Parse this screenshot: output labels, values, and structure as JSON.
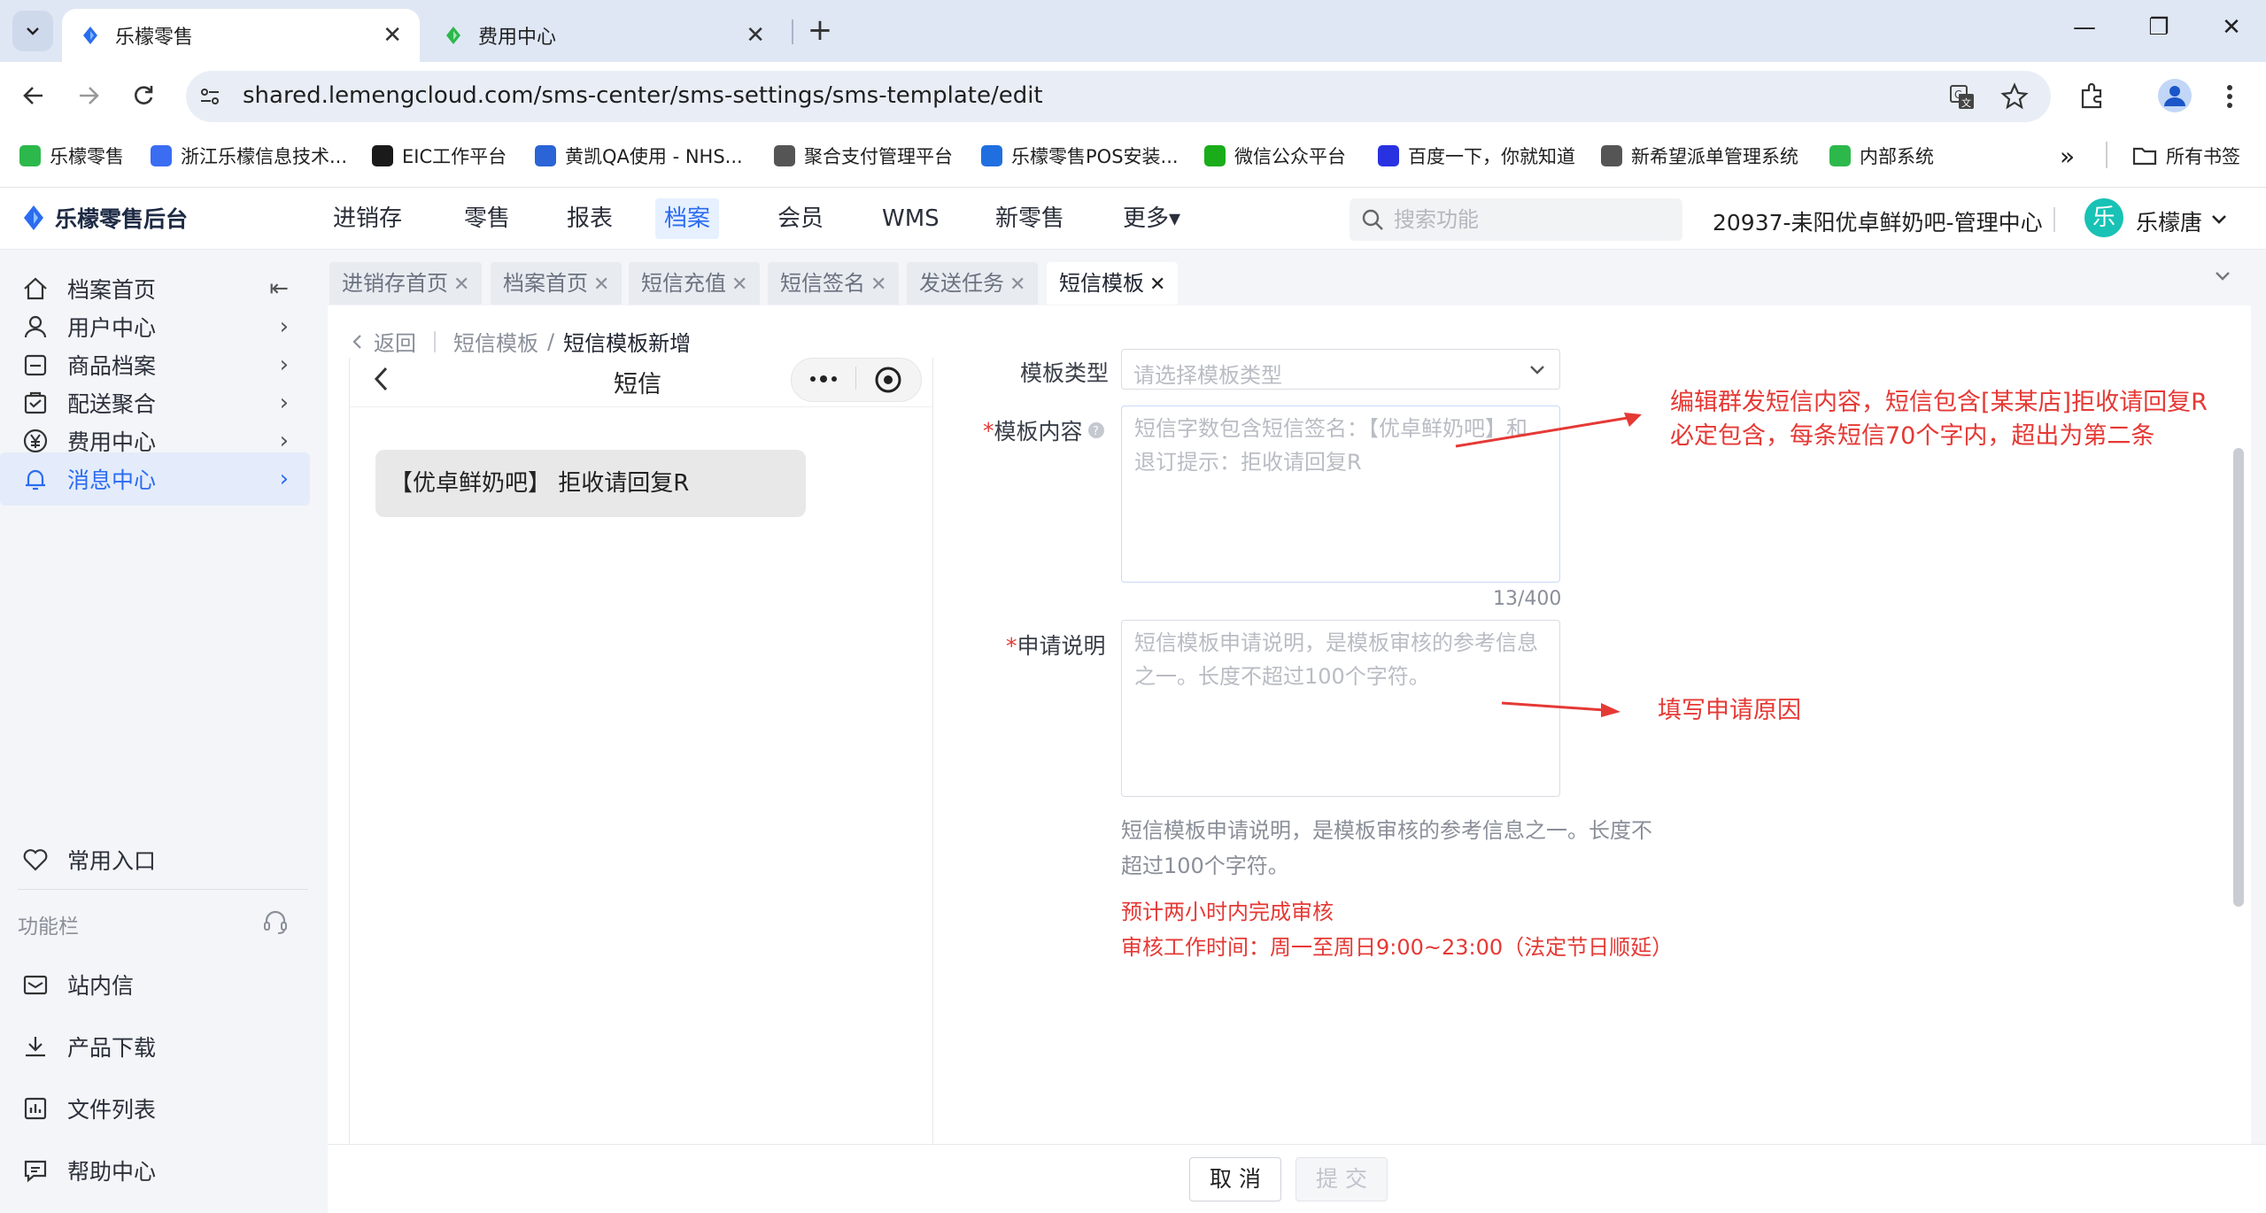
{
  "browser": {
    "tabs": [
      {
        "title": "乐檬零售",
        "active": true
      },
      {
        "title": "费用中心",
        "active": false
      }
    ],
    "close_glyph": "✕",
    "new_tab_glyph": "+",
    "url": "shared.lemengcloud.com/sms-center/sms-settings/sms-template/edit",
    "window_controls": {
      "minimize": "—",
      "restore": "❐",
      "close": "✕"
    },
    "bookmarks": [
      {
        "label": "乐檬零售",
        "color": "#2db84c"
      },
      {
        "label": "浙江乐檬信息技术...",
        "color": "#3b6df2"
      },
      {
        "label": "EIC工作平台",
        "color": "#1a1a1a"
      },
      {
        "label": "黄凯QA使用 - NHS...",
        "color": "#2a64d6"
      },
      {
        "label": "聚合支付管理平台",
        "color": "#555555"
      },
      {
        "label": "乐檬零售POS安装...",
        "color": "#1f6fe0"
      },
      {
        "label": "微信公众平台",
        "color": "#1aad19"
      },
      {
        "label": "百度一下，你就知道",
        "color": "#2932e1"
      },
      {
        "label": "新希望派单管理系统",
        "color": "#555555"
      },
      {
        "label": "内部系统",
        "color": "#2db84c"
      }
    ],
    "more_bookmarks": "»",
    "all_bookmarks": "所有书签"
  },
  "app": {
    "brand": "乐檬零售后台",
    "nav": [
      {
        "label": "进销存",
        "active": false
      },
      {
        "label": "零售",
        "active": false
      },
      {
        "label": "报表",
        "active": false
      },
      {
        "label": "档案",
        "active": true
      },
      {
        "label": "会员",
        "active": false
      },
      {
        "label": "WMS",
        "active": false
      },
      {
        "label": "新零售",
        "active": false
      },
      {
        "label": "更多▾",
        "active": false
      }
    ],
    "search_placeholder": "搜索功能",
    "store": "20937-耒阳优卓鲜奶吧-管理中心",
    "avatar_char": "乐",
    "user": "乐檬唐",
    "accent": "#2b6cf0"
  },
  "sidebar": {
    "items": [
      {
        "label": "档案首页",
        "icon": "home-icon",
        "trail": "collapse-icon"
      },
      {
        "label": "用户中心",
        "icon": "user-icon",
        "trail": "chevron-right-icon"
      },
      {
        "label": "商品档案",
        "icon": "goods-icon",
        "trail": "chevron-right-icon"
      },
      {
        "label": "配送聚合",
        "icon": "delivery-icon",
        "trail": "chevron-right-icon"
      },
      {
        "label": "费用中心",
        "icon": "yen-icon",
        "trail": "chevron-right-icon"
      },
      {
        "label": "消息中心",
        "icon": "bell-icon",
        "trail": "chevron-right-icon",
        "active": true
      }
    ],
    "common_entry": "常用入口",
    "function_bar": "功能栏",
    "bottom_items": [
      {
        "label": "站内信",
        "icon": "mail-icon"
      },
      {
        "label": "产品下载",
        "icon": "download-icon"
      },
      {
        "label": "文件列表",
        "icon": "chart-list-icon"
      },
      {
        "label": "帮助中心",
        "icon": "help-chat-icon"
      }
    ],
    "chevron": "›",
    "collapse": "⇤"
  },
  "page_tabs": [
    {
      "label": "进销存首页"
    },
    {
      "label": "档案首页"
    },
    {
      "label": "短信充值"
    },
    {
      "label": "短信签名"
    },
    {
      "label": "发送任务"
    },
    {
      "label": "短信模板",
      "active": true
    }
  ],
  "tab_close": "✕",
  "breadcrumb": {
    "back": "返回",
    "parent": "短信模板",
    "sep": "/",
    "current": "短信模板新增"
  },
  "preview": {
    "title": "短信",
    "message": "【优卓鲜奶吧】 拒收请回复R"
  },
  "form": {
    "template_type": {
      "label": "模板类型",
      "placeholder": "请选择模板类型"
    },
    "template_content": {
      "required": "*",
      "label": "模板内容",
      "placeholder": "短信字数包含短信签名：【优卓鲜奶吧】和退订提示：拒收请回复R",
      "counter": "13/400"
    },
    "apply_note": {
      "required": "*",
      "label": "申请说明",
      "placeholder": "短信模板申请说明，是模板审核的参考信息之一。长度不超过100个字符。"
    },
    "help": "短信模板申请说明，是模板审核的参考信息之一。长度不超过100个字符。",
    "review_note_1": "预计两小时内完成审核",
    "review_note_2": "审核工作时间：周一至周日9:00~23:00（法定节日顺延）"
  },
  "annotations": {
    "content_line1": "编辑群发短信内容，短信包含[某某店]拒收请回复R",
    "content_line2": "必定包含，每条短信70个字内，超出为第二条",
    "apply": "填写申请原因"
  },
  "buttons": {
    "cancel": "取 消",
    "submit": "提 交"
  }
}
